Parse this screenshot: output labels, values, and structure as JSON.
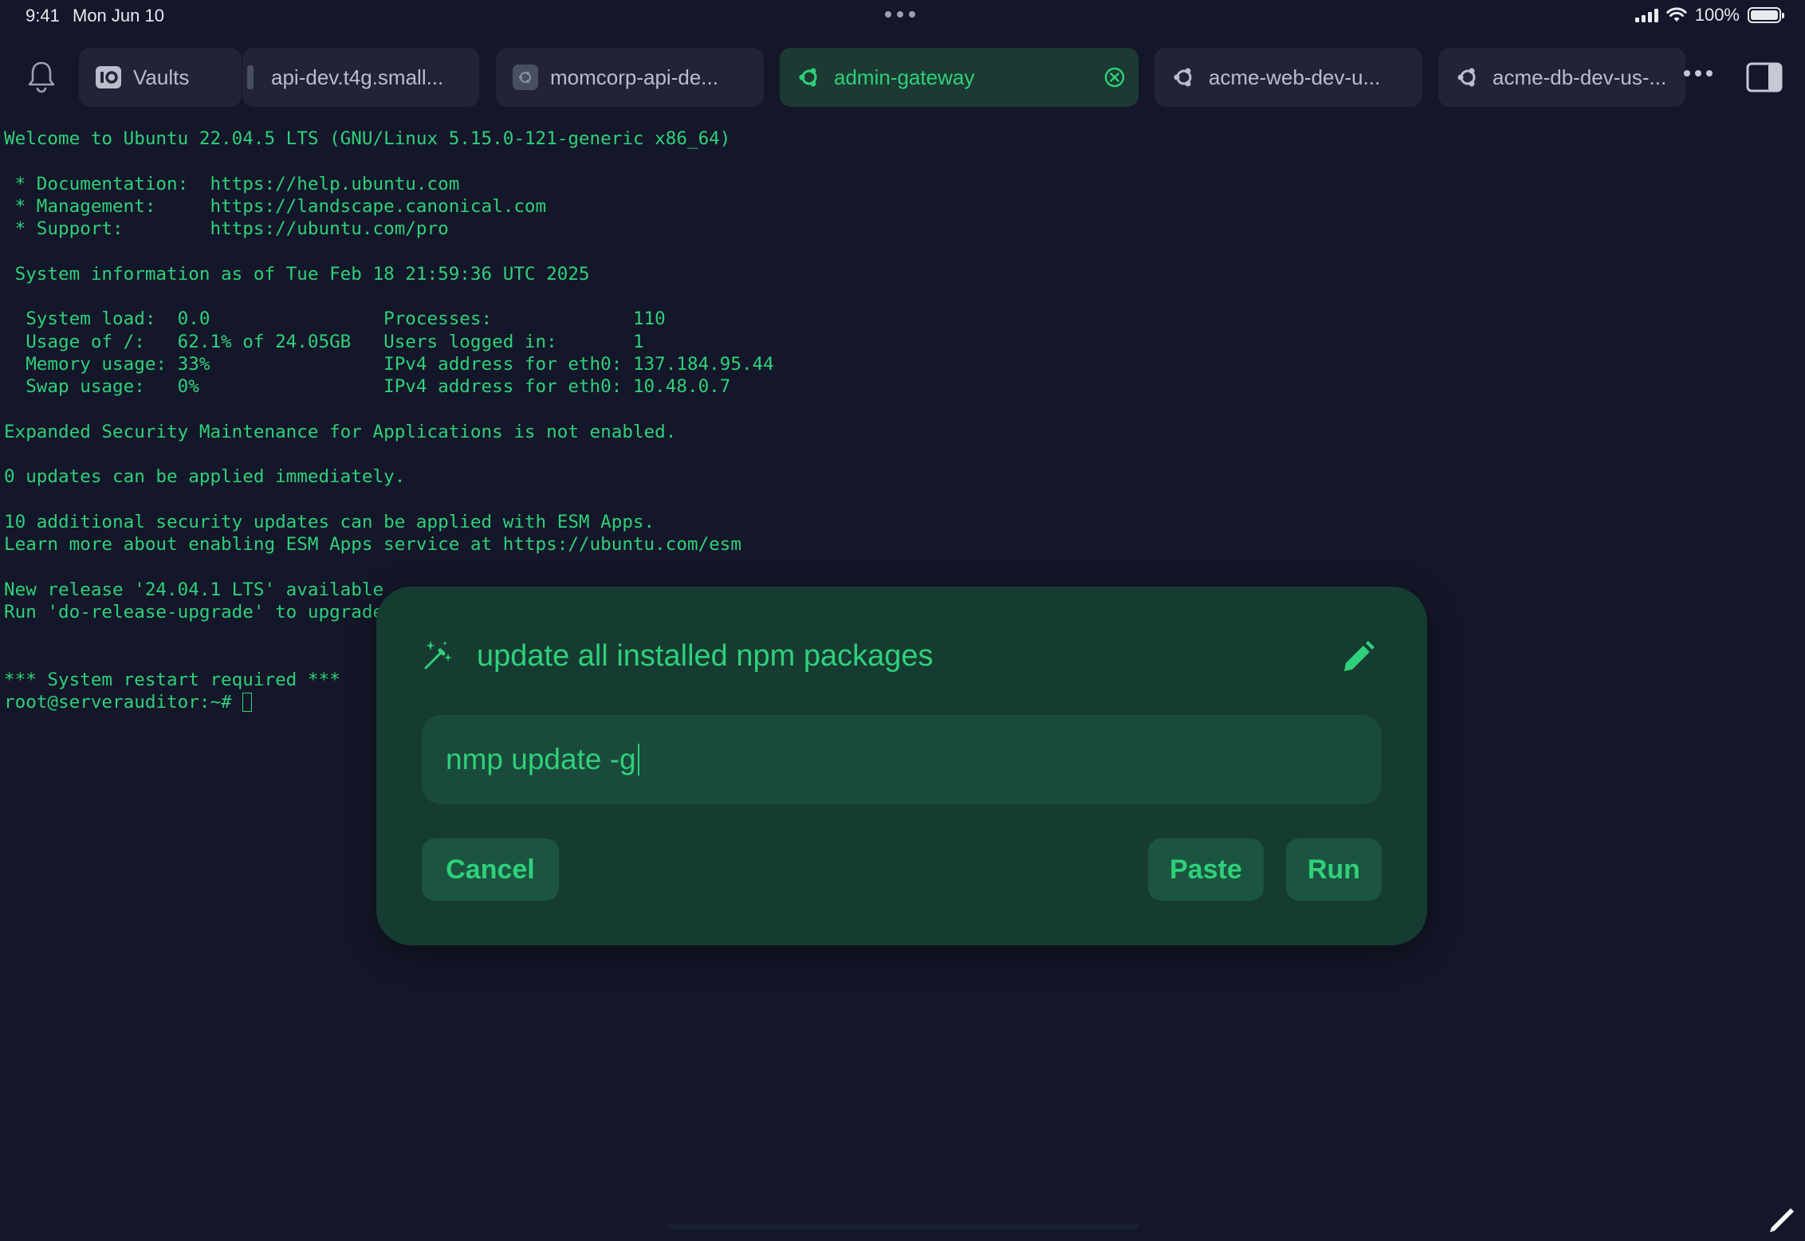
{
  "status_bar": {
    "time": "9:41",
    "date": "Mon Jun 10",
    "battery": "100%",
    "battery_level": 1.0,
    "icons": [
      "signal-icon",
      "wifi-icon",
      "battery-icon"
    ]
  },
  "tabs": [
    {
      "label": "Vaults",
      "icon": "vault-icon",
      "active": false
    },
    {
      "label": "api-dev.t4g.small...",
      "icon": "",
      "active": false
    },
    {
      "label": "momcorp-api-de...",
      "icon": "server-icon",
      "active": false
    },
    {
      "label": "admin-gateway",
      "icon": "ubuntu-icon",
      "active": true
    },
    {
      "label": "acme-web-dev-u...",
      "icon": "ubuntu-icon",
      "active": false
    },
    {
      "label": "acme-db-dev-us-...",
      "icon": "ubuntu-icon",
      "active": false
    }
  ],
  "terminal": {
    "lines": [
      "Welcome to Ubuntu 22.04.5 LTS (GNU/Linux 5.15.0-121-generic x86_64)",
      "",
      " * Documentation:  https://help.ubuntu.com",
      " * Management:     https://landscape.canonical.com",
      " * Support:        https://ubuntu.com/pro",
      "",
      " System information as of Tue Feb 18 21:59:36 UTC 2025",
      "",
      "  System load:  0.0                Processes:             110",
      "  Usage of /:   62.1% of 24.05GB   Users logged in:       1",
      "  Memory usage: 33%                IPv4 address for eth0: 137.184.95.44",
      "  Swap usage:   0%                 IPv4 address for eth0: 10.48.0.7",
      "",
      "Expanded Security Maintenance for Applications is not enabled.",
      "",
      "0 updates can be applied immediately.",
      "",
      "10 additional security updates can be applied with ESM Apps.",
      "Learn more about enabling ESM Apps service at https://ubuntu.com/esm",
      "",
      "New release '24.04.1 LTS' available",
      "Run 'do-release-upgrade' to upgrade",
      "",
      "",
      "*** System restart required ***"
    ],
    "prompt": "root@serverauditor:~# "
  },
  "dialog": {
    "title": "update all installed npm packages",
    "command": "nmp update -g",
    "cancel_label": "Cancel",
    "paste_label": "Paste",
    "run_label": "Run"
  },
  "colors": {
    "background": "#141729",
    "accent": "#2fd07a",
    "dialog_bg": "#163c31",
    "tab_bg": "#212435"
  }
}
